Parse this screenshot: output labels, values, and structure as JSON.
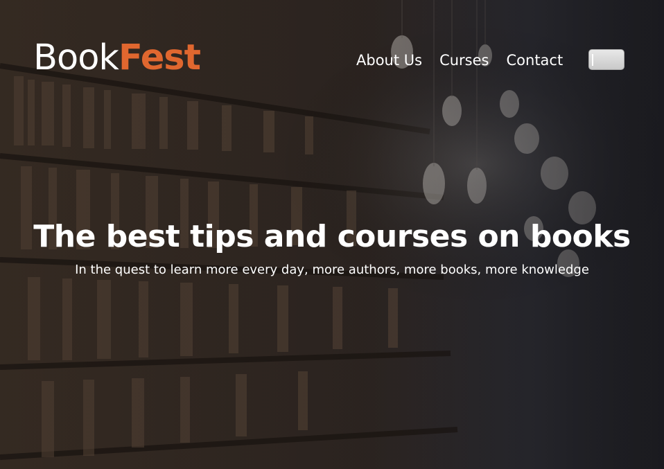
{
  "brand": {
    "part1": "Book",
    "part2": "Fest",
    "accent_color": "#e0672f"
  },
  "nav": {
    "items": [
      {
        "label": "About Us"
      },
      {
        "label": "Curses"
      },
      {
        "label": "Contact"
      }
    ]
  },
  "hero": {
    "title": "The best tips and courses on books",
    "subtitle": "In the quest to learn more every day, more authors, more books, more knowledge"
  },
  "colors": {
    "text": "#ffffff",
    "background": "#1d1c1e"
  }
}
